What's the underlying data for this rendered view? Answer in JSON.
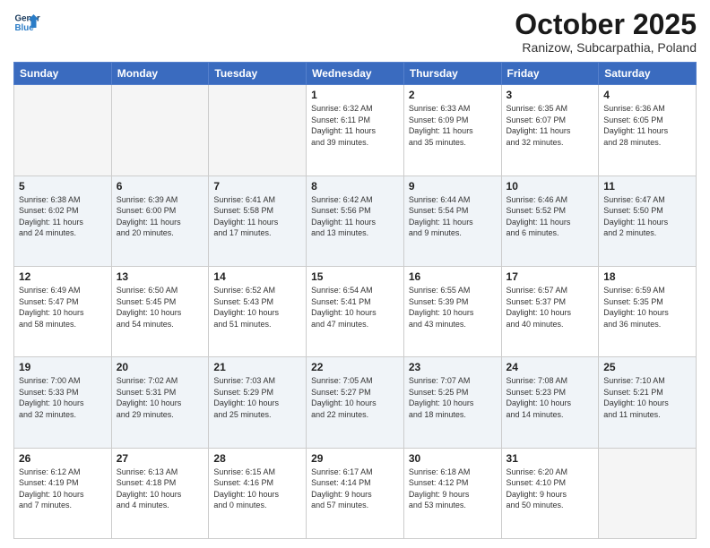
{
  "header": {
    "logo_line1": "General",
    "logo_line2": "Blue",
    "month": "October 2025",
    "location": "Ranizow, Subcarpathia, Poland"
  },
  "weekdays": [
    "Sunday",
    "Monday",
    "Tuesday",
    "Wednesday",
    "Thursday",
    "Friday",
    "Saturday"
  ],
  "weeks": [
    [
      {
        "day": "",
        "info": ""
      },
      {
        "day": "",
        "info": ""
      },
      {
        "day": "",
        "info": ""
      },
      {
        "day": "1",
        "info": "Sunrise: 6:32 AM\nSunset: 6:11 PM\nDaylight: 11 hours\nand 39 minutes."
      },
      {
        "day": "2",
        "info": "Sunrise: 6:33 AM\nSunset: 6:09 PM\nDaylight: 11 hours\nand 35 minutes."
      },
      {
        "day": "3",
        "info": "Sunrise: 6:35 AM\nSunset: 6:07 PM\nDaylight: 11 hours\nand 32 minutes."
      },
      {
        "day": "4",
        "info": "Sunrise: 6:36 AM\nSunset: 6:05 PM\nDaylight: 11 hours\nand 28 minutes."
      }
    ],
    [
      {
        "day": "5",
        "info": "Sunrise: 6:38 AM\nSunset: 6:02 PM\nDaylight: 11 hours\nand 24 minutes."
      },
      {
        "day": "6",
        "info": "Sunrise: 6:39 AM\nSunset: 6:00 PM\nDaylight: 11 hours\nand 20 minutes."
      },
      {
        "day": "7",
        "info": "Sunrise: 6:41 AM\nSunset: 5:58 PM\nDaylight: 11 hours\nand 17 minutes."
      },
      {
        "day": "8",
        "info": "Sunrise: 6:42 AM\nSunset: 5:56 PM\nDaylight: 11 hours\nand 13 minutes."
      },
      {
        "day": "9",
        "info": "Sunrise: 6:44 AM\nSunset: 5:54 PM\nDaylight: 11 hours\nand 9 minutes."
      },
      {
        "day": "10",
        "info": "Sunrise: 6:46 AM\nSunset: 5:52 PM\nDaylight: 11 hours\nand 6 minutes."
      },
      {
        "day": "11",
        "info": "Sunrise: 6:47 AM\nSunset: 5:50 PM\nDaylight: 11 hours\nand 2 minutes."
      }
    ],
    [
      {
        "day": "12",
        "info": "Sunrise: 6:49 AM\nSunset: 5:47 PM\nDaylight: 10 hours\nand 58 minutes."
      },
      {
        "day": "13",
        "info": "Sunrise: 6:50 AM\nSunset: 5:45 PM\nDaylight: 10 hours\nand 54 minutes."
      },
      {
        "day": "14",
        "info": "Sunrise: 6:52 AM\nSunset: 5:43 PM\nDaylight: 10 hours\nand 51 minutes."
      },
      {
        "day": "15",
        "info": "Sunrise: 6:54 AM\nSunset: 5:41 PM\nDaylight: 10 hours\nand 47 minutes."
      },
      {
        "day": "16",
        "info": "Sunrise: 6:55 AM\nSunset: 5:39 PM\nDaylight: 10 hours\nand 43 minutes."
      },
      {
        "day": "17",
        "info": "Sunrise: 6:57 AM\nSunset: 5:37 PM\nDaylight: 10 hours\nand 40 minutes."
      },
      {
        "day": "18",
        "info": "Sunrise: 6:59 AM\nSunset: 5:35 PM\nDaylight: 10 hours\nand 36 minutes."
      }
    ],
    [
      {
        "day": "19",
        "info": "Sunrise: 7:00 AM\nSunset: 5:33 PM\nDaylight: 10 hours\nand 32 minutes."
      },
      {
        "day": "20",
        "info": "Sunrise: 7:02 AM\nSunset: 5:31 PM\nDaylight: 10 hours\nand 29 minutes."
      },
      {
        "day": "21",
        "info": "Sunrise: 7:03 AM\nSunset: 5:29 PM\nDaylight: 10 hours\nand 25 minutes."
      },
      {
        "day": "22",
        "info": "Sunrise: 7:05 AM\nSunset: 5:27 PM\nDaylight: 10 hours\nand 22 minutes."
      },
      {
        "day": "23",
        "info": "Sunrise: 7:07 AM\nSunset: 5:25 PM\nDaylight: 10 hours\nand 18 minutes."
      },
      {
        "day": "24",
        "info": "Sunrise: 7:08 AM\nSunset: 5:23 PM\nDaylight: 10 hours\nand 14 minutes."
      },
      {
        "day": "25",
        "info": "Sunrise: 7:10 AM\nSunset: 5:21 PM\nDaylight: 10 hours\nand 11 minutes."
      }
    ],
    [
      {
        "day": "26",
        "info": "Sunrise: 6:12 AM\nSunset: 4:19 PM\nDaylight: 10 hours\nand 7 minutes."
      },
      {
        "day": "27",
        "info": "Sunrise: 6:13 AM\nSunset: 4:18 PM\nDaylight: 10 hours\nand 4 minutes."
      },
      {
        "day": "28",
        "info": "Sunrise: 6:15 AM\nSunset: 4:16 PM\nDaylight: 10 hours\nand 0 minutes."
      },
      {
        "day": "29",
        "info": "Sunrise: 6:17 AM\nSunset: 4:14 PM\nDaylight: 9 hours\nand 57 minutes."
      },
      {
        "day": "30",
        "info": "Sunrise: 6:18 AM\nSunset: 4:12 PM\nDaylight: 9 hours\nand 53 minutes."
      },
      {
        "day": "31",
        "info": "Sunrise: 6:20 AM\nSunset: 4:10 PM\nDaylight: 9 hours\nand 50 minutes."
      },
      {
        "day": "",
        "info": ""
      }
    ]
  ]
}
